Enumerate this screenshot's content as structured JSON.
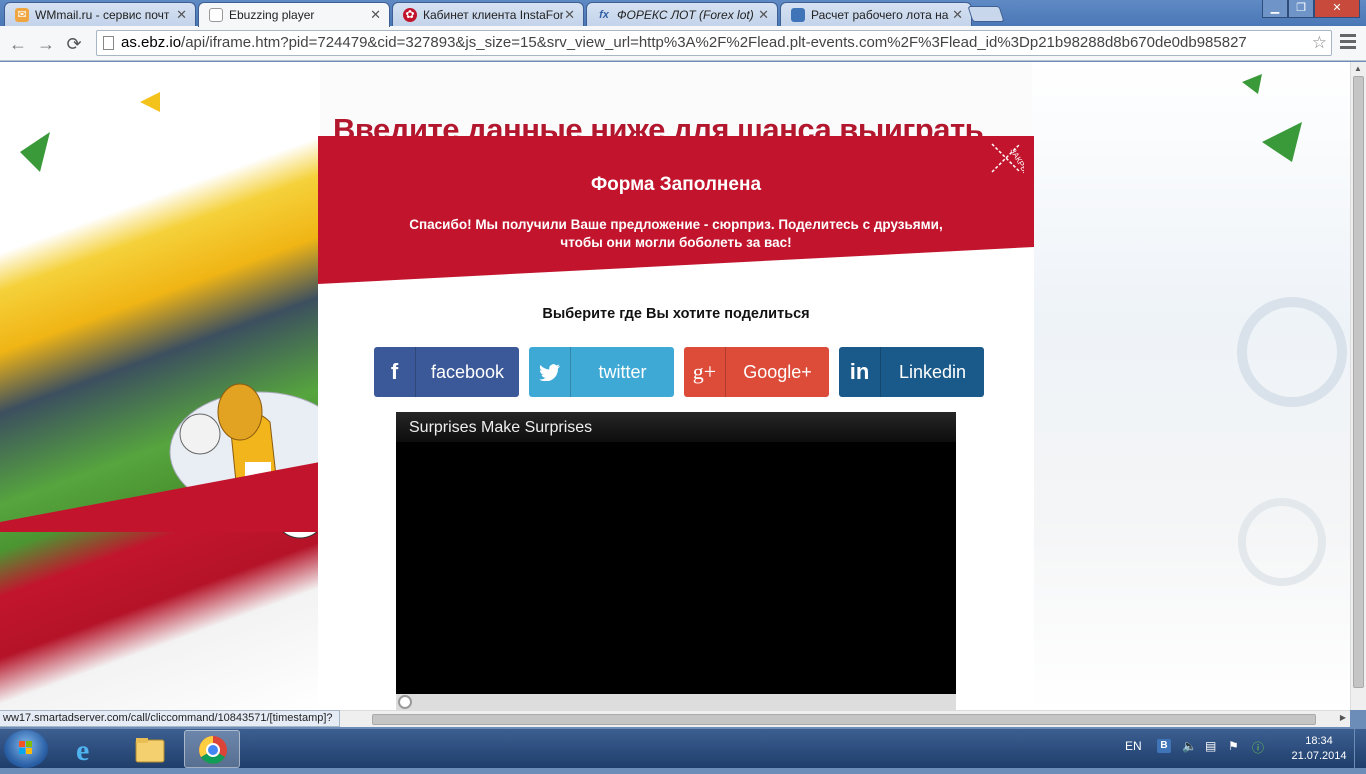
{
  "browser": {
    "tabs": [
      {
        "label": "WMmail.ru - сервис почт",
        "favicon": "wmmail-icon",
        "color": "#f0a640"
      },
      {
        "label": "Ebuzzing player",
        "favicon": "page-icon",
        "color": "#ffffff",
        "active": true
      },
      {
        "label": "Кабинет клиента InstaFor",
        "favicon": "instaforex-icon",
        "color": "#c2152d"
      },
      {
        "label": "ФОРЕКС ЛОТ (Forex lot)",
        "favicon": "fx-icon",
        "color": "#3560a8"
      },
      {
        "label": "Расчет рабочего лота на",
        "favicon": "doc-icon",
        "color": "#3f74b8"
      }
    ],
    "url": {
      "host": "as.ebz.io",
      "path": "/api/iframe.htm?pid=724479&cid=327893&js_size=15&srv_view_url=http%3A%2F%2Flead.plt-events.com%2F%3Flead_id%3Dp21b98288d8b670de0db985827"
    },
    "status_url": "ww17.smartadserver.com/call/cliccommand/10843571/[timestamp]?"
  },
  "page": {
    "headline": "Введите данные  ниже для шанса выиграть",
    "form_title": "Форма Заполнена",
    "form_message_line1": "Спасибо! Мы получили Ваше предложение - сюрприз. Поделитесь с друзьями,",
    "form_message_line2": "чтобы они могли боболеть за вас!",
    "close_label": "ЗАКРЫТЬ",
    "share_title": "Выберите где Вы хотите поделиться",
    "share_buttons": [
      {
        "label": "facebook",
        "icon": "f",
        "color": "#3b5998"
      },
      {
        "label": "twitter",
        "icon": "twitter-bird",
        "color": "#3fa9d6"
      },
      {
        "label": "Google+",
        "icon": "g+",
        "color": "#dd4b39"
      },
      {
        "label": "Linkedin",
        "icon": "in",
        "color": "#1a5a8a"
      }
    ],
    "video_title": "Surprises Make Surprises",
    "brand_red": "#c2152d"
  },
  "taskbar": {
    "language": "EN",
    "time": "18:34",
    "date": "21.07.2014"
  }
}
